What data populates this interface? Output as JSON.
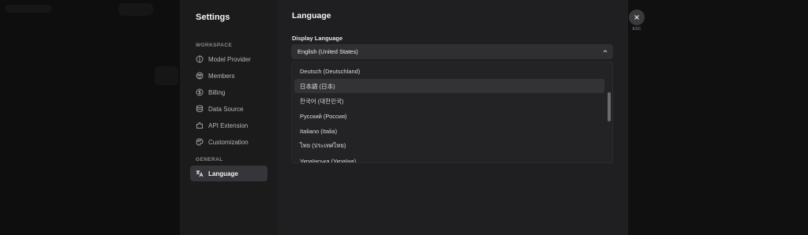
{
  "sidebar": {
    "title": "Settings",
    "workspace_label": "WORKSPACE",
    "general_label": "GENERAL",
    "items": [
      {
        "label": "Model Provider",
        "icon": "model-provider-icon"
      },
      {
        "label": "Members",
        "icon": "members-icon"
      },
      {
        "label": "Billing",
        "icon": "billing-icon"
      },
      {
        "label": "Data Source",
        "icon": "database-icon"
      },
      {
        "label": "API Extension",
        "icon": "api-extension-icon"
      },
      {
        "label": "Customization",
        "icon": "customization-icon"
      }
    ],
    "general_items": [
      {
        "label": "Language",
        "icon": "translate-icon",
        "active": true
      }
    ]
  },
  "main": {
    "title": "Language",
    "display_language_label": "Display Language",
    "selected_language": "English (United States)",
    "options": [
      "Deutsch (Deutschland)",
      "日本語 (日本)",
      "한국어 (대한민국)",
      "Русский (Россия)",
      "Italiano (Italia)",
      "ไทย (ประเทศไทย)",
      "Українська (Україна)"
    ],
    "hovered_option_index": 1
  },
  "close": {
    "esc_label": "ESC"
  },
  "colors": {
    "page_bg": "#101010",
    "sidebar_bg": "#1b1b1c",
    "main_bg": "#1f1f21",
    "select_bg": "#2f2f32",
    "active_item_bg": "#36363a"
  }
}
